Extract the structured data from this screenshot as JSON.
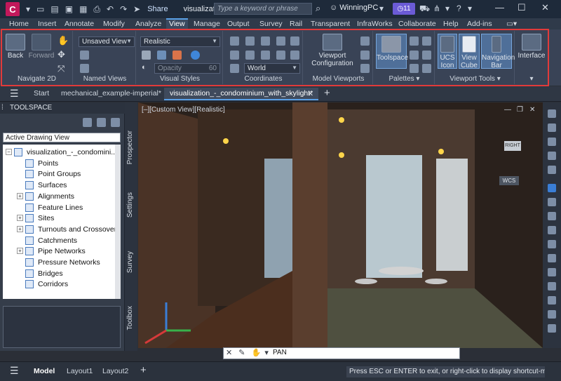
{
  "titlebar": {
    "logo": "C",
    "share": "Share",
    "doc_title": "visualizati...",
    "search_placeholder": "Type a keyword or phrase",
    "user": "WinningPC",
    "badge": "11"
  },
  "menu": [
    "Home",
    "Insert",
    "Annotate",
    "Modify",
    "Analyze",
    "View",
    "Manage",
    "Output",
    "Survey",
    "Rail",
    "Transparent",
    "InfraWorks",
    "Collaborate",
    "Help",
    "Add-ins"
  ],
  "ribbon": {
    "navigate2d": {
      "title": "Navigate 2D",
      "back": "Back",
      "forward": "Forward"
    },
    "named_views": {
      "title": "Named Views",
      "dropdown": "Unsaved View"
    },
    "visual_styles": {
      "title": "Visual Styles",
      "dropdown": "Realistic",
      "opacity": "Opacity",
      "opacity_value": "60"
    },
    "coordinates": {
      "title": "Coordinates",
      "dropdown": "World"
    },
    "model_viewports": {
      "title": "Model Viewports",
      "viewport_config": "Viewport Configuration"
    },
    "palettes": {
      "title": "Palettes",
      "toolspace": "Toolspace"
    },
    "viewport_tools": {
      "title": "Viewport Tools",
      "ucs_icon": "UCS Icon",
      "view_cube": "View Cube",
      "navigation_bar": "Navigation Bar"
    },
    "interface": {
      "label": "Interface"
    }
  },
  "doc_tabs": {
    "start": "Start",
    "tab1": "mechanical_example-imperial*",
    "tab2": "visualization_-_condominium_with_skylight*"
  },
  "toolspace": {
    "title": "TOOLSPACE",
    "view": "Active Drawing View",
    "root": "visualization_-_condomini...",
    "items": [
      "Points",
      "Point Groups",
      "Surfaces",
      "Alignments",
      "Feature Lines",
      "Sites",
      "Turnouts and Crossovers",
      "Catchments",
      "Pipe Networks",
      "Pressure Networks",
      "Bridges",
      "Corridors"
    ],
    "sidetabs": [
      "Prospector",
      "Settings",
      "Survey",
      "Toolbox"
    ]
  },
  "viewport": {
    "label": "[–][Custom View][Realistic]",
    "cube_right": "RIGHT",
    "wcs": "WCS"
  },
  "command": {
    "text": "PAN"
  },
  "status": {
    "model": "Model",
    "layout1": "Layout1",
    "layout2": "Layout2",
    "message": "Press ESC or ENTER to exit, or right-click to display shortcut-menu."
  }
}
